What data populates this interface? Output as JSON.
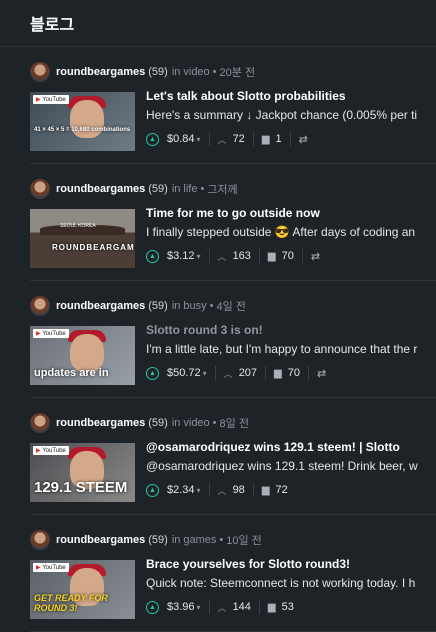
{
  "header": {
    "title": "블로그"
  },
  "posts": [
    {
      "author": "roundbeargames",
      "rep": "(59)",
      "in_label": "in",
      "category": "video",
      "time": "20분 전",
      "title": "Let's talk about Slotto probabilities",
      "excerpt": "Here's a summary ↓ Jackpot chance (0.005% per ti",
      "payout": "$0.84",
      "votes": "72",
      "comments": "1",
      "thumb_label": "",
      "thumb_small": "41 × 45 × 5 = 10,680 combinations"
    },
    {
      "author": "roundbeargames",
      "rep": "(59)",
      "in_label": "in",
      "category": "life",
      "time": "그저께",
      "title": "Time for me to go outside now",
      "excerpt": "I finally stepped outside 😎  After days of coding an",
      "payout": "$3.12",
      "votes": "163",
      "comments": "70",
      "thumb_label": "ROUNDBEARGAMES",
      "thumb_small": "SEOUL KOREA"
    },
    {
      "author": "roundbeargames",
      "rep": "(59)",
      "in_label": "in",
      "category": "busy",
      "time": "4일 전",
      "title": "Slotto round 3 is on!",
      "excerpt": "I'm a little late, but I'm happy to announce that the r",
      "payout": "$50.72",
      "votes": "207",
      "comments": "70",
      "thumb_label": "updates are in",
      "thumb_small": ""
    },
    {
      "author": "roundbeargames",
      "rep": "(59)",
      "in_label": "in",
      "category": "video",
      "time": "8일 전",
      "title": "@osamarodriquez wins 129.1 steem! | Slotto",
      "excerpt": "@osamarodriquez wins 129.1 steem! Drink beer, w",
      "payout": "$2.34",
      "votes": "98",
      "comments": "72",
      "thumb_label": "129.1 STEEM",
      "thumb_small": ""
    },
    {
      "author": "roundbeargames",
      "rep": "(59)",
      "in_label": "in",
      "category": "games",
      "time": "10일 전",
      "title": "Brace yourselves for Slotto round3!",
      "excerpt": "Quick note: Steemconnect is not working today. I h",
      "payout": "$3.96",
      "votes": "144",
      "comments": "53",
      "thumb_label": "GET READY FOR ROUND 3!",
      "thumb_small": ""
    }
  ],
  "common": {
    "bullet": "•",
    "youtube": "YouTube",
    "caret": "▾"
  },
  "colors": {
    "background": "#1e2328",
    "upvote": "#27c4a0"
  }
}
